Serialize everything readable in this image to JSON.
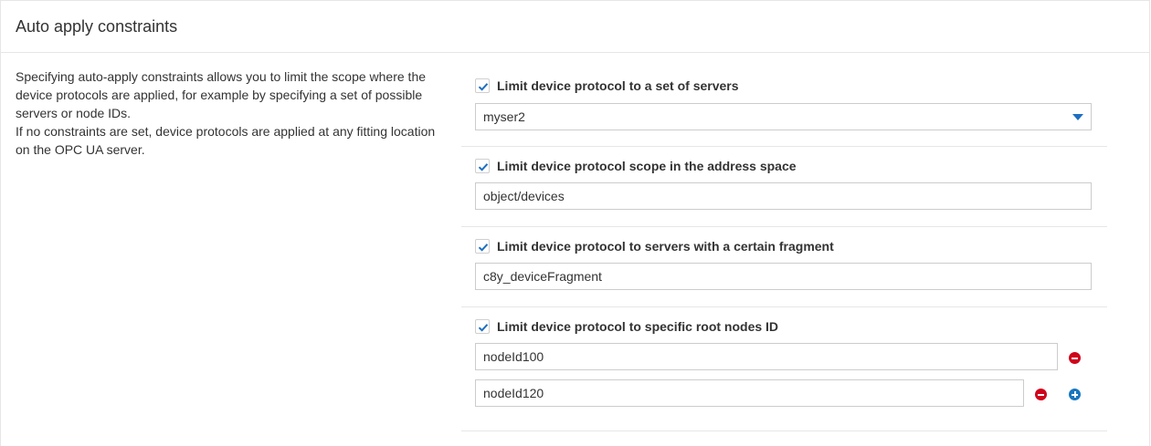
{
  "card": {
    "title": "Auto apply constraints"
  },
  "description": {
    "paragraph1": "Specifying auto-apply constraints allows you to limit the scope where the device protocols are applied, for example by specifying a set of possible servers or node IDs.",
    "paragraph2": "If no constraints are set, device protocols are applied at any fitting location on the OPC UA server."
  },
  "constraints": {
    "servers": {
      "label": "Limit device protocol to a set of servers",
      "checked": true,
      "selected_value": "myser2"
    },
    "address_space": {
      "label": "Limit device protocol scope in the address space",
      "checked": true,
      "value": "object/devices"
    },
    "fragment": {
      "label": "Limit device protocol to servers with a certain fragment",
      "checked": true,
      "value": "c8y_deviceFragment"
    },
    "root_nodes": {
      "label": "Limit device protocol to specific root nodes ID",
      "checked": true,
      "items": [
        "nodeId100",
        "nodeId120"
      ]
    }
  },
  "colors": {
    "accent_blue": "#1776bf",
    "remove_red": "#d0021b",
    "border": "#cccccc",
    "checkmark": "#1d6fc1"
  },
  "icons": {
    "checkbox": "checkmark-icon",
    "dropdown": "caret-down-icon",
    "remove": "minus-circle-icon",
    "add": "plus-circle-icon"
  }
}
